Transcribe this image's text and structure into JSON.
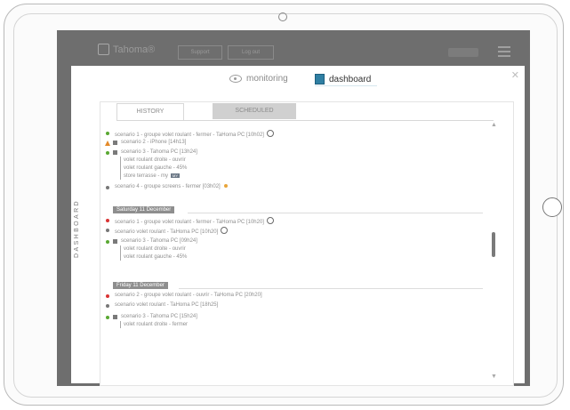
{
  "app": {
    "logo_text": "Tahoma®",
    "header_button_1": "Support",
    "header_button_2": "Log out"
  },
  "top_tabs": {
    "monitoring": "monitoring",
    "dashboard": "dashboard"
  },
  "subtabs": {
    "history": "HISTORY",
    "scheduled": "SCHEDULED"
  },
  "side_label": "DASHBOARD",
  "history": {
    "group1": [
      {
        "status": "green",
        "text": "scenario 1 - groupe volet roulant - fermer - TaHoma PC [10h02]",
        "icon": "clock-icon"
      },
      {
        "status": "warning",
        "text": "scenario 2 - iPhone [14h13]"
      },
      {
        "status": "green",
        "text": "scenario 3 - Tahoma PC [13h24]",
        "details": [
          "volet roulant droite - ouvrir",
          "volet roulant gauche - 45%",
          "store terrasse - my"
        ],
        "tag": "MY"
      },
      {
        "status": "gray",
        "text": "scenario 4 - groupe screens - fermer [03h02]",
        "icon": "sun-icon"
      }
    ],
    "date2": "Saturday 11 December",
    "group2": [
      {
        "status": "red",
        "text": "scenario 1 - groupe volet roulant - fermer - TaHoma PC [10h20]",
        "icon": "clock-icon"
      },
      {
        "status": "gray",
        "text": "scenario volet roulant - TaHoma PC [10h20]",
        "icon": "clock-icon"
      },
      {
        "status": "green",
        "text": "scenario 3 - Tahoma PC [09h24]",
        "details": [
          "volet roulant droite - ouvrir",
          "volet roulant gauche - 45%"
        ]
      }
    ],
    "date3": "Friday 11 December",
    "group3": [
      {
        "status": "red",
        "text": "scenario 2 - groupe volet roulant - ouvrir - TaHoma PC [20h20]"
      },
      {
        "status": "gray",
        "text": "scenario volet roulant - TaHoma PC [18h25]"
      },
      {
        "status": "green",
        "text": "scenario 3 - Tahoma PC [15h24]",
        "details": [
          "volet roulant droite - fermer"
        ]
      }
    ]
  },
  "colors": {
    "green": "#5aa832",
    "red": "#d93434",
    "warning": "#e48a2a",
    "accent": "#2f7fa3"
  }
}
